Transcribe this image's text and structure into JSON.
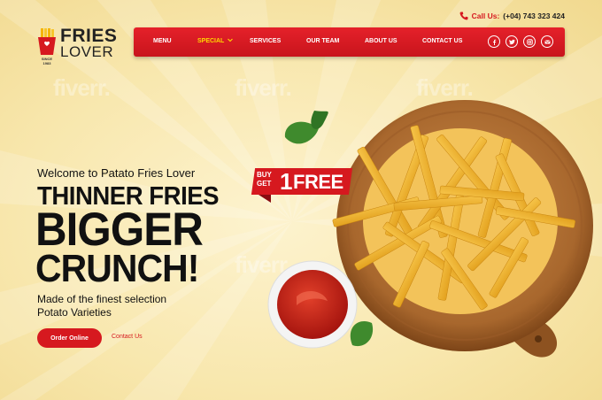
{
  "brand": {
    "name_line1": "FRIES",
    "name_line2": "LOVER",
    "since": "SINCE 1983"
  },
  "contact": {
    "label": "Call Us:",
    "phone": "(+04) 743 323 424",
    "icon": "phone-icon"
  },
  "nav": {
    "items": [
      {
        "label": "MENU"
      },
      {
        "label": "SPECIAL",
        "active": true
      },
      {
        "label": "SERVICES"
      },
      {
        "label": "OUR TEAM"
      },
      {
        "label": "ABOUT US"
      },
      {
        "label": "CONTACT US"
      }
    ],
    "social": [
      "facebook-icon",
      "twitter-icon",
      "instagram-icon",
      "email-icon"
    ]
  },
  "watermark": "fiverr.",
  "hero": {
    "welcome": "Welcome to Patato Fries Lover",
    "line1": "THINNER FRIES",
    "line2": "BIGGER",
    "line3": "CRUNCH!",
    "desc_line1": "Made of the finest selection",
    "desc_line2": "Potato Varieties",
    "order_button": "Order Online",
    "contact_link": "Contact Us"
  },
  "badge": {
    "buy": "BUY",
    "get": "GET",
    "one": "1",
    "free": "FREE"
  },
  "colors": {
    "accent": "#d6191f",
    "active_nav": "#ffd800",
    "background": "#f8e7ad"
  }
}
